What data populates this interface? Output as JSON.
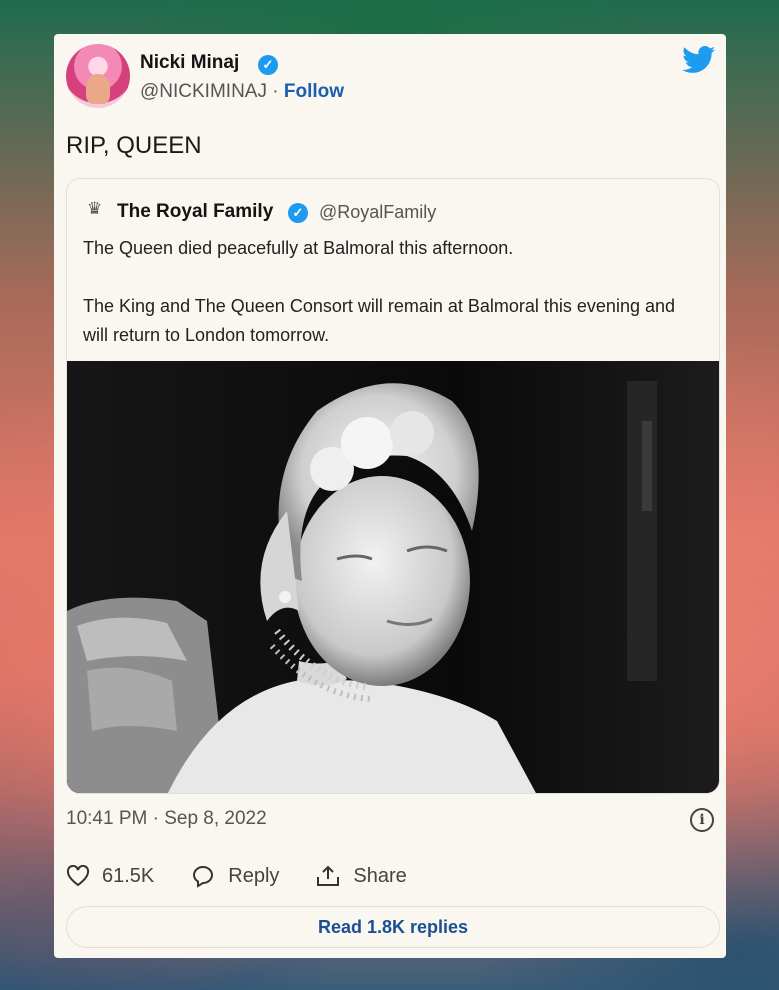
{
  "author": {
    "name": "Nicki Minaj",
    "handle": "@NICKIMINAJ",
    "separator": "·",
    "follow_label": "Follow"
  },
  "tweet": {
    "text": "RIP, QUEEN",
    "timestamp": "10:41 PM · Sep 8, 2022"
  },
  "quoted": {
    "name": "The Royal Family",
    "handle": "@RoyalFamily",
    "text_line1": "The Queen died peacefully at Balmoral this afternoon.",
    "text_line2": "The King and The Queen Consort will remain at Balmoral this evening and will return to London tomorrow."
  },
  "actions": {
    "likes": "61.5K",
    "reply_label": "Reply",
    "share_label": "Share"
  },
  "read_replies_label": "Read 1.8K replies",
  "icons": [
    "verified-icon",
    "twitter-bird-icon",
    "royal-crest-icon",
    "heart-icon",
    "reply-bubble-icon",
    "share-icon",
    "info-icon"
  ],
  "colors": {
    "card_background": "#f9f7f0",
    "twitter_blue": "#1d9bf0",
    "follow_link": "#1b5fae",
    "read_replies_text": "#1b4f93"
  }
}
